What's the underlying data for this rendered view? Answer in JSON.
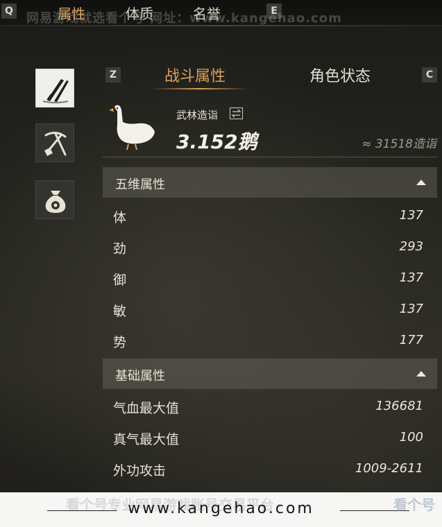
{
  "top_nav": {
    "key_left": "Q",
    "tabs": [
      {
        "label": "属性",
        "active": true
      },
      {
        "label": "体质",
        "active": false
      },
      {
        "label": "名誉",
        "active": false
      }
    ],
    "key_right": "E",
    "watermark": "网易游戏就选看个号  网址：www.kangehao.com"
  },
  "side_icons": [
    {
      "icon": "weapons-icon",
      "active": true
    },
    {
      "icon": "tools-icon",
      "active": false
    },
    {
      "icon": "money-bag-icon",
      "active": false
    }
  ],
  "panel": {
    "key_left": "Z",
    "tabs": [
      {
        "label": "战斗属性",
        "active": true
      },
      {
        "label": "角色状态",
        "active": false
      }
    ],
    "key_right": "C",
    "rating": {
      "label": "武林造诣",
      "value": "3.152鹅",
      "approx": "≈ 31518造诣"
    },
    "sections": [
      {
        "title": "五维属性",
        "rows": [
          {
            "name": "体",
            "value": "137"
          },
          {
            "name": "劲",
            "value": "293"
          },
          {
            "name": "御",
            "value": "137"
          },
          {
            "name": "敏",
            "value": "137"
          },
          {
            "name": "势",
            "value": "177"
          }
        ]
      },
      {
        "title": "基础属性",
        "rows": [
          {
            "name": "气血最大值",
            "value": "136681"
          },
          {
            "name": "真气最大值",
            "value": "100"
          },
          {
            "name": "外功攻击",
            "value": "1009-2611"
          }
        ]
      }
    ]
  },
  "footer": {
    "url": "www.kangehao.com",
    "ghost_text": "看个号专业网易游戏账号交易平台",
    "brand": "看个号"
  },
  "colors": {
    "accent": "#d9a25a",
    "text": "#e9e4d6",
    "section_bg": "#6e6c62"
  }
}
